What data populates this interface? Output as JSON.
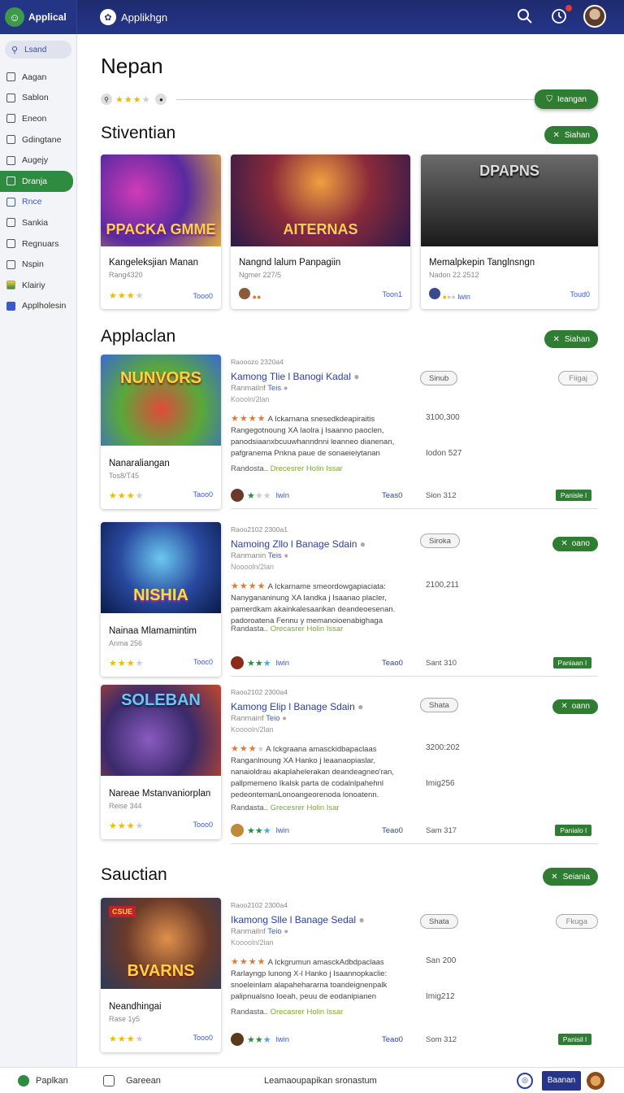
{
  "brand": {
    "label": "Applical"
  },
  "header": {
    "title": "Applikhgn"
  },
  "sidebar": {
    "search": "Lsand",
    "items": [
      {
        "label": "Aagan"
      },
      {
        "label": "Sablon"
      },
      {
        "label": "Eneon"
      },
      {
        "label": "Gdingtane"
      },
      {
        "label": "Augejy"
      },
      {
        "label": "Dranja"
      },
      {
        "label": "Rnce"
      },
      {
        "label": "Sankia"
      },
      {
        "label": "Regnuars"
      },
      {
        "label": "Nspin"
      },
      {
        "label": "Klairiy"
      },
      {
        "label": "Applholesin"
      }
    ]
  },
  "page": {
    "title": "Nepan",
    "top_button": "Ieangan"
  },
  "featured": {
    "title": "Stiventian",
    "button": "Siahan",
    "cards": [
      {
        "art": "PPACKA GMME",
        "title": "Kangeleksjian Manan",
        "sub": "Rang4320",
        "link": "Tooo0"
      },
      {
        "art": "AITERNAS",
        "title": "Nangnd lalum Panpagiin",
        "sub": "Ngmer 227/5",
        "link": "Toon1"
      },
      {
        "art": "DPAPNS",
        "title": "Memalpkepin Tanglnsngn",
        "sub": "Nadon 22.2512",
        "link": "Toud0",
        "extra": "lwin"
      }
    ]
  },
  "applications": {
    "title": "Applaclan",
    "button": "Siahan",
    "rows": [
      {
        "art": "NUNVORS",
        "card_title": "Nanaraliangan",
        "card_sub": "Tos8/T45",
        "card_link": "Taoo0",
        "meta": "Raooozo 2320a4",
        "name": "Kamong Tlie l Banogi Kadal",
        "pub": "Ranmailnf",
        "pub_tag": "Teis",
        "pub2": "Koooln/2lan",
        "desc": "A Ickarnana snesedkdeapiraitis Rangegotnoung XA Iaolra j Isaanno paoclen, panodsiaanxbcuuwhanndnni leanneo dianenan, pafgranema Pnkna paue de sonaeieiytanan",
        "tags": "Randosta..",
        "tags_hi": "Drecesrer Holin Issar",
        "num1": "3100,300",
        "num2": "Iodon 527",
        "ghost": "Sinub",
        "right": "Fiigaj",
        "right_green": false,
        "link": "lwin",
        "mid": "Teas0",
        "size": "Sion 312",
        "badge": "Panisle l"
      },
      {
        "art": "NISHIA",
        "card_title": "Nainaa Mlamamintim",
        "card_sub": "Anma 256",
        "card_link": "Tooc0",
        "meta": "Raoo2102 2300a1",
        "name": "Namoing Zllo l Banage Sdain",
        "pub": "Ranmanin",
        "pub_tag": "Teis",
        "pub2": "Nooooln/2lan",
        "desc": "A Ickarname smeordowgapiaciata: Nanygananinung XA Iandka j Isaanao placler, pamerdkam akainkalesaarikan deandeoesenan. padoroatena Fennu y memanoioenabighaga",
        "tags": "Randasta..",
        "tags_hi": "Orecasrer Holin Issar",
        "num1": "2100,211",
        "num2": "",
        "ghost": "Siroka",
        "right": "oano",
        "right_green": true,
        "link": "lwin",
        "mid": "Teao0",
        "size": "Sant 310",
        "badge": "Paniaan l"
      },
      {
        "art": "SOLEBAN",
        "card_title": "Nareae Mstanvaniorplan",
        "card_sub": "Reise 344",
        "card_link": "Tooo0",
        "meta": "Raoo2102 2300a4",
        "name": "Kamong Elip l Banage Sdain",
        "pub": "Ranmainf",
        "pub_tag": "Teio",
        "pub2": "Kooooln/2lan",
        "desc": "A Ickgraana amasckidbapaclaas Ranganlnoung XA Hanko j leaanaopiaslar, nanaioldrau akaplahelerakan deandeagneo'ran, pallpmemeno Ikalsk parta de codalnlpahehnl pedeontemanLonoangeorenoda lonoatenn.",
        "tags": "Randasta..",
        "tags_hi": "Grecesrer Holin Isar",
        "num1": "3200:202",
        "num2": "Imig256",
        "ghost": "Shata",
        "right": "oann",
        "right_green": true,
        "link": "lwin",
        "mid": "Teao0",
        "size": "Sam 317",
        "badge": "Panialo l"
      }
    ]
  },
  "section3": {
    "title": "Sauctian",
    "button": "Seiania",
    "row": {
      "art": "BVARNS",
      "badge_art": "CSUE",
      "card_title": "Neandhingai",
      "card_sub": "Rase 1y5",
      "card_link": "Tooo0",
      "meta": "Raoo2102 2300a4",
      "name": "Ikamong Slle l Banage Sedal",
      "pub": "Ranmailnf",
      "pub_tag": "Teio",
      "pub2": "Kooooln/2lan",
      "desc": "A Ickgrumun amasckAdbdpaclaas Rarlayngp lunong X-l Hanko j Isaannopkaclie: snoeleinlam alapahehararna toandeignenpalk palipnualsno Ioeah, peuu de eodanipianen",
      "tags": "Randasta..",
      "tags_hi": "Orecasrer Holin Issar",
      "num1": "San 200",
      "num2": "Imig212",
      "ghost": "Shata",
      "right": "Fkuga",
      "link": "lwin",
      "mid": "Teao0",
      "size": "Som 312",
      "badge": "Panisil l"
    }
  },
  "bottombar": {
    "item1": "Paplkan",
    "item2": "Gareean",
    "item3": "Leamaoupapikan sronastum",
    "btn": "Baanan"
  }
}
